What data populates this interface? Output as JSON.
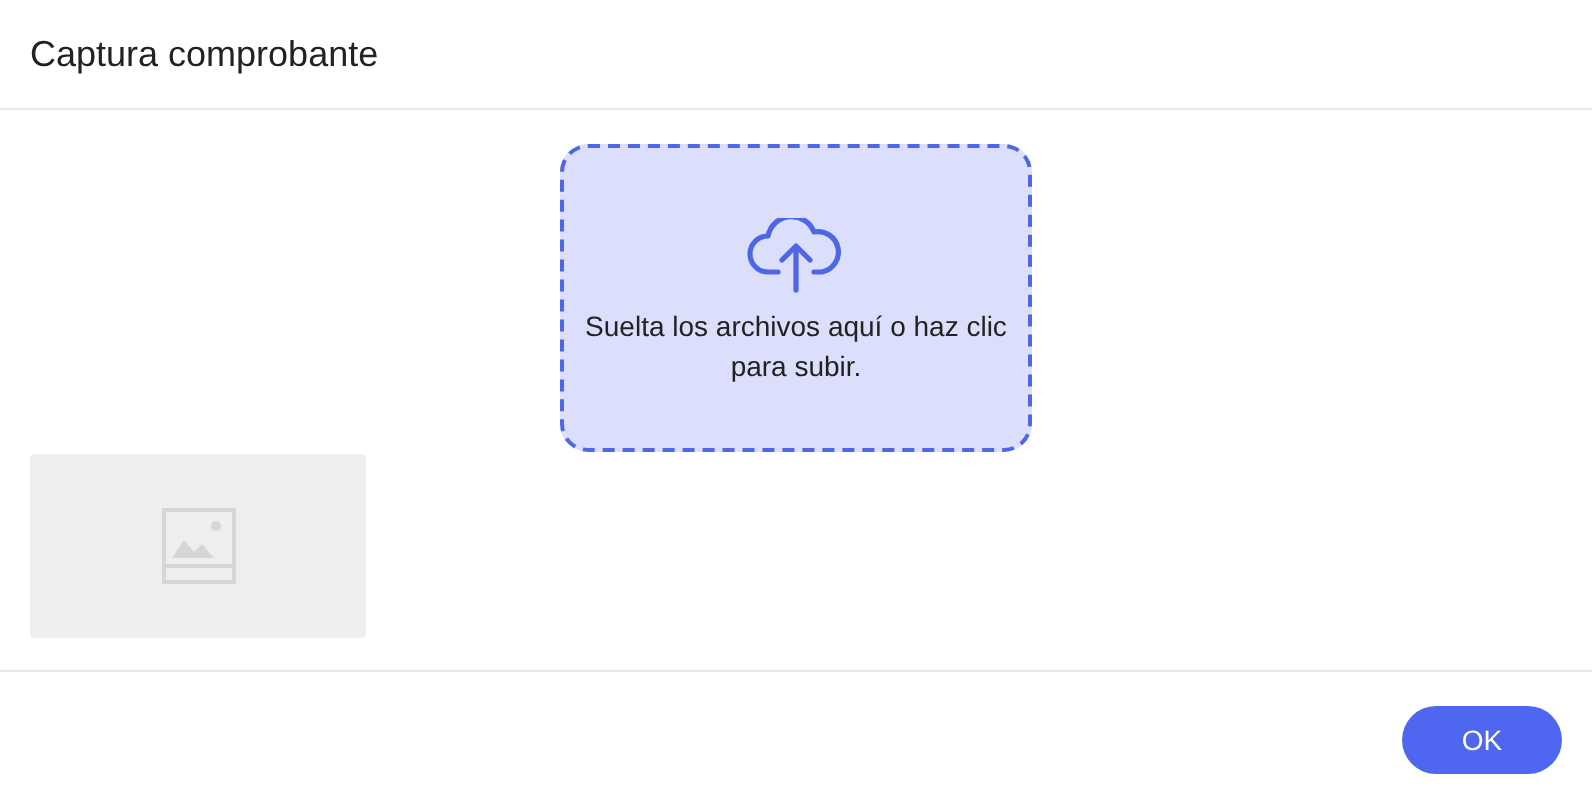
{
  "window": {
    "title": "Captura comprobante"
  },
  "dropzone": {
    "text": "Suelta los archivos aquí o haz clic para subir."
  },
  "buttons": [
    "OK"
  ]
}
